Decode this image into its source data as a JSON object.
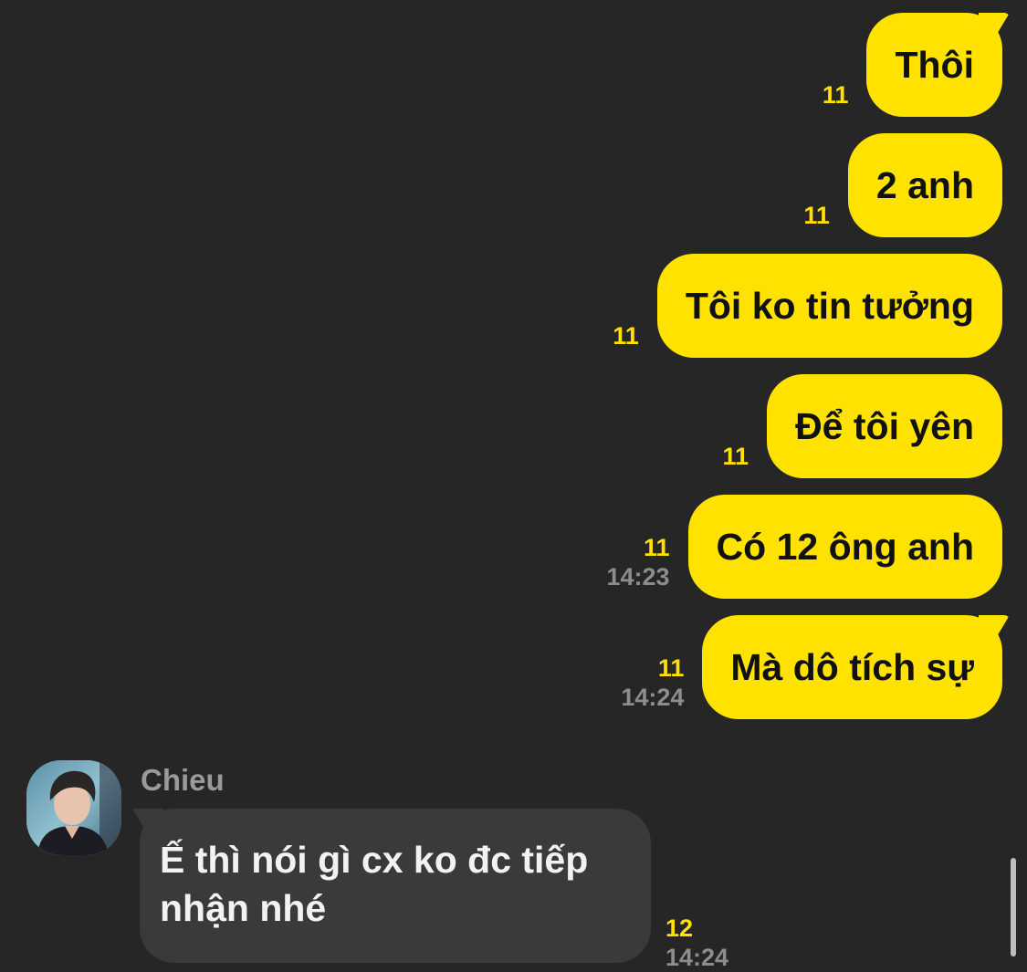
{
  "messages_out": [
    {
      "text": "Thôi",
      "unread": "11",
      "time": ""
    },
    {
      "text": "2 anh",
      "unread": "11",
      "time": ""
    },
    {
      "text": "Tôi ko tin tưởng",
      "unread": "11",
      "time": ""
    },
    {
      "text": "Để tôi yên",
      "unread": "11",
      "time": ""
    },
    {
      "text": "Có 12 ông anh",
      "unread": "11",
      "time": "14:23"
    },
    {
      "text": "Mà dô tích sự",
      "unread": "11",
      "time": "14:24"
    }
  ],
  "incoming": {
    "sender": "Chieu",
    "text": "Ế thì nói gì cx ko đc tiếp nhận nhé",
    "unread": "12",
    "time": "14:24",
    "avatar_icon": "profile-photo"
  },
  "colors": {
    "background": "#262626",
    "outgoing_bubble": "#ffe200",
    "incoming_bubble": "#3a3a3c",
    "unread_count": "#ffe000",
    "timestamp": "#8d8d8d"
  }
}
